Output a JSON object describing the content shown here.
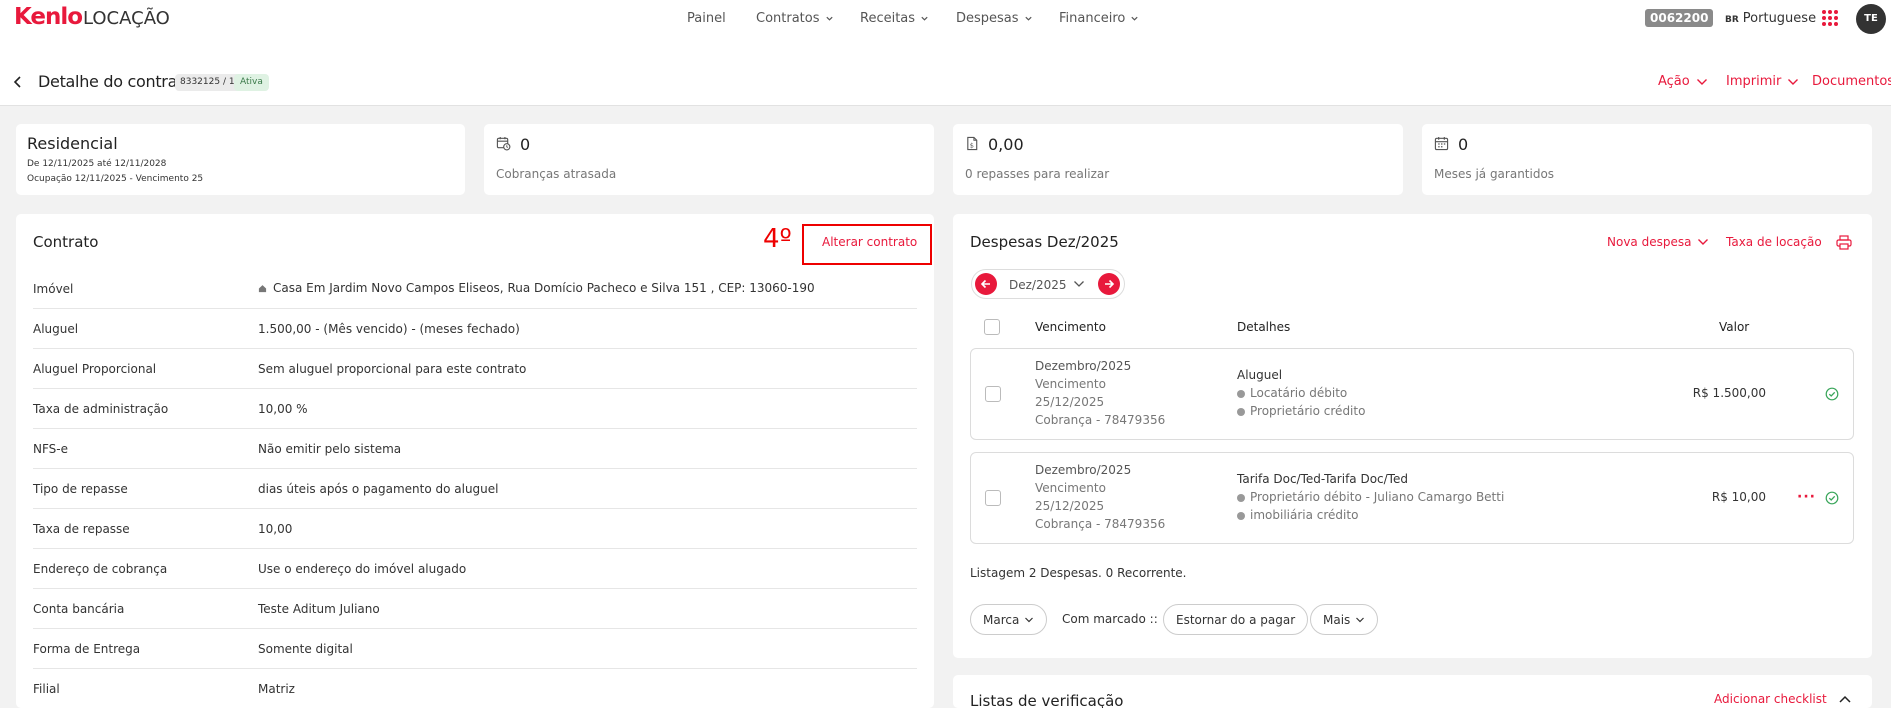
{
  "nav": {
    "logo_brand": "Kenlo",
    "logo_product": "LOCAÇÃO",
    "items": [
      {
        "label": "Painel",
        "dropdown": false
      },
      {
        "label": "Contratos",
        "dropdown": true
      },
      {
        "label": "Receitas",
        "dropdown": true
      },
      {
        "label": "Despesas",
        "dropdown": true
      },
      {
        "label": "Financeiro",
        "dropdown": true
      }
    ],
    "account_code": "0062200",
    "lang_flag": "BR",
    "lang_label": "Portuguese",
    "avatar_initials": "TE"
  },
  "header": {
    "title": "Detalhe do contrato",
    "contract_id": "8332125 / 1",
    "status": "Ativa",
    "actions": [
      {
        "label": "Ação",
        "dropdown": true
      },
      {
        "label": "Imprimir",
        "dropdown": true
      },
      {
        "label": "Documentos",
        "dropdown": false
      }
    ]
  },
  "summary": {
    "type": "Residencial",
    "period": "De 12/11/2025 até 12/11/2028",
    "occupancy": "Ocupação 12/11/2025 - Vencimento 25",
    "cards": [
      {
        "icon": "calendar-clock-icon",
        "value": "0",
        "label": "Cobranças atrasada"
      },
      {
        "icon": "document-money-icon",
        "value": "0,00",
        "label": "0 repasses para realizar"
      },
      {
        "icon": "calendar-icon",
        "value": "0",
        "label": "Meses já garantidos"
      }
    ]
  },
  "contract": {
    "title": "Contrato",
    "step_annotation": "4º",
    "edit_label": "Alterar contrato",
    "rows": [
      {
        "label": "Imóvel",
        "value": "Casa Em Jardim Novo Campos Eliseos, Rua Domício Pacheco e Silva 151 , CEP: 13060-190"
      },
      {
        "label": "Aluguel",
        "value": "1.500,00 - (Mês vencido) - (meses fechado)"
      },
      {
        "label": "Aluguel Proporcional",
        "value": "Sem aluguel proporcional para este contrato"
      },
      {
        "label": "Taxa de administração",
        "value": "10,00 %"
      },
      {
        "label": "NFS-e",
        "value": "Não emitir pelo sistema"
      },
      {
        "label": "Tipo de repasse",
        "value": "dias úteis após o pagamento do aluguel"
      },
      {
        "label": "Taxa de repasse",
        "value": "10,00"
      },
      {
        "label": "Endereço de cobrança",
        "value": "Use o endereço do imóvel alugado"
      },
      {
        "label": "Conta bancária",
        "value": "Teste Aditum Juliano"
      },
      {
        "label": "Forma de Entrega",
        "value": "Somente digital"
      },
      {
        "label": "Filial",
        "value": "Matriz"
      }
    ]
  },
  "expenses": {
    "title": "Despesas Dez/2025",
    "new_label": "Nova despesa",
    "fee_label": "Taxa de locação",
    "month": "Dez/2025",
    "columns": {
      "due": "Vencimento",
      "details": "Detalhes",
      "value": "Valor"
    },
    "items": [
      {
        "month": "Dezembro/2025",
        "due_label": "Vencimento",
        "due_date": "25/12/2025",
        "charge": "Cobrança - 78479356",
        "title": "Aluguel",
        "line1": "Locatário débito",
        "line2": "Proprietário crédito",
        "value": "R$ 1.500,00",
        "has_menu": false
      },
      {
        "month": "Dezembro/2025",
        "due_label": "Vencimento",
        "due_date": "25/12/2025",
        "charge": "Cobrança - 78479356",
        "title": "Tarifa Doc/Ted-Tarifa Doc/Ted",
        "line1": "Proprietário débito - Juliano Camargo Betti",
        "line2": "imobiliária crédito",
        "value": "R$ 10,00",
        "has_menu": true
      }
    ],
    "summary": "Listagem 2 Despesas. 0 Recorrente.",
    "marca_label": "Marca",
    "with_marked_label": "Com marcado ::",
    "reverse_label": "Estornar do a pagar",
    "more_label": "Mais"
  },
  "checklist": {
    "title": "Listas de verificação",
    "add_label": "Adicionar checklist"
  }
}
